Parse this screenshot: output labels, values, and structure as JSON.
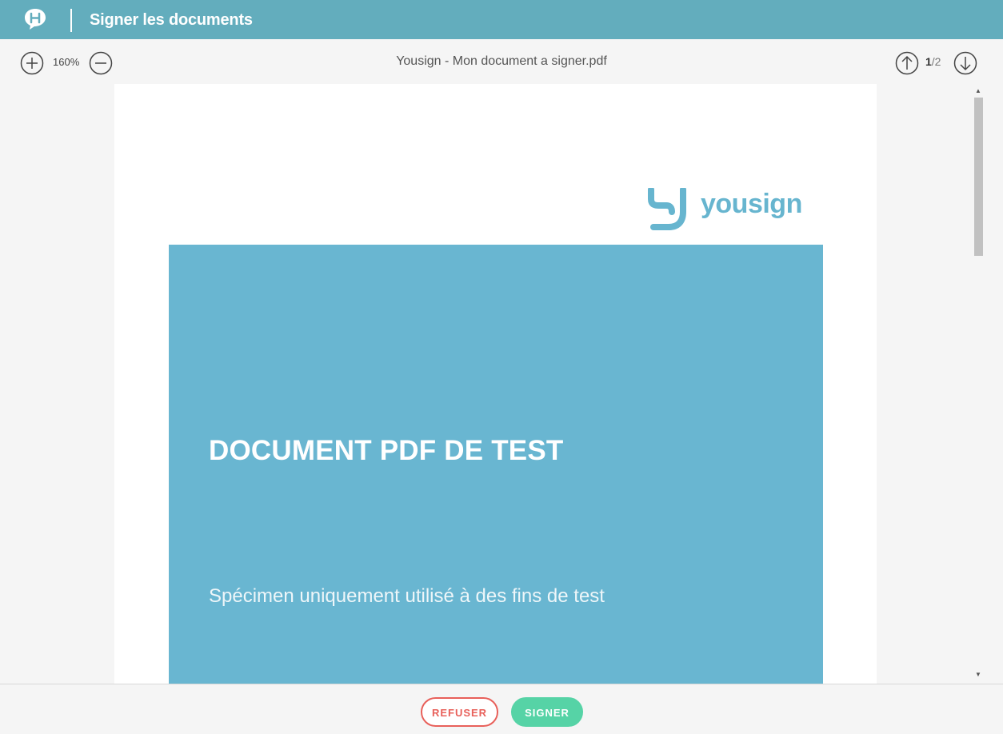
{
  "header": {
    "title": "Signer les documents",
    "logo_icon": "chat-bubble-h-logo",
    "bg_color": "#63adbd"
  },
  "toolbar": {
    "zoom_in_icon": "plus-circle-icon",
    "zoom_level": "160%",
    "zoom_out_icon": "minus-circle-icon",
    "document_title": "Yousign - Mon document a signer.pdf",
    "page_up_icon": "arrow-up-circle-icon",
    "current_page": "1",
    "total_pages": "/2",
    "page_down_icon": "arrow-down-circle-icon"
  },
  "document": {
    "brand_name": "yousign",
    "heading": "DOCUMENT PDF DE TEST",
    "subtitle": "Spécimen uniquement utilisé à des fins de test",
    "brand_color": "#69b6d1"
  },
  "actions": {
    "refuse_label": "REFUSER",
    "sign_label": "SIGNER",
    "refuse_color": "#e8605a",
    "sign_color": "#56d3a6"
  }
}
